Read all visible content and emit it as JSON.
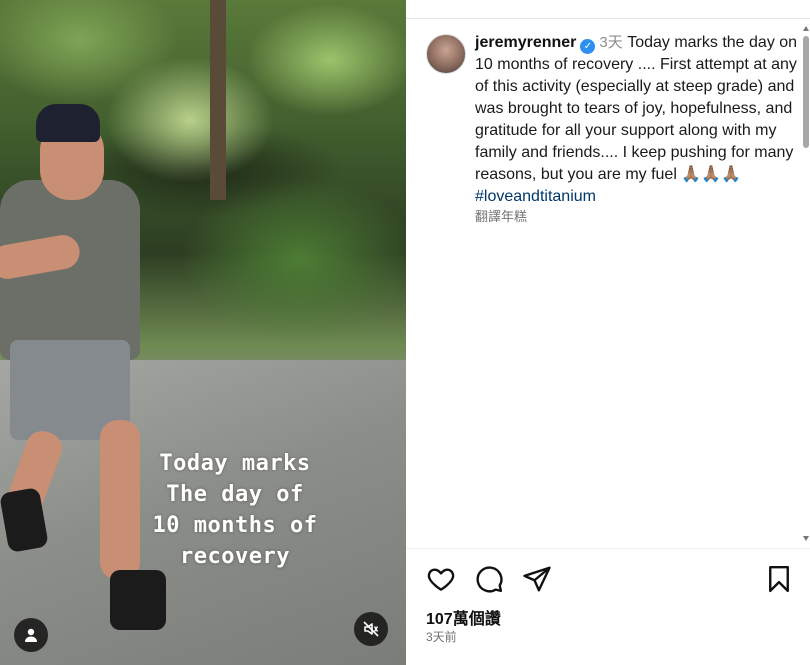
{
  "media": {
    "overlay_lines": [
      "Today marks",
      "The day of",
      "10 months of",
      "recovery"
    ]
  },
  "post": {
    "username": "jeremyrenner",
    "posted_ago": "3天",
    "caption": "Today marks the day on 10 months of recovery .... First attempt at any of this activity (especially at steep grade) and was brought to tears of joy, hopefulness, and gratitude for all your support along with my family and friends.... I keep pushing for many reasons, but you are my fuel 🙏🏽🙏🏽🙏🏽",
    "hashtag": "#loveandtitanium",
    "translate_label": "翻譯年糕",
    "likes": "107萬個讚",
    "footer_time": "3天前"
  },
  "colors": {
    "verified": "#2e8ff0",
    "hashtag": "#00376b",
    "muted_text": "#737373"
  },
  "icons": {
    "like": "heart-icon",
    "comment": "comment-icon",
    "share": "share-icon",
    "save": "bookmark-icon",
    "mute": "sound-off-icon",
    "profile": "person-icon",
    "verified": "verified-badge-icon"
  }
}
